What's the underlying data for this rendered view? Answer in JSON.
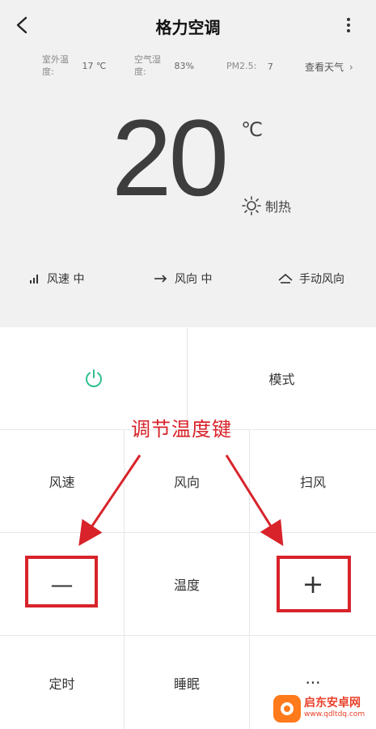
{
  "header": {
    "title": "格力空调"
  },
  "info": {
    "outdoor_temp_label": "室外温度:",
    "outdoor_temp_value": "17 ℃",
    "humidity_label": "空气湿度:",
    "humidity_value": "83%",
    "pm25_label": "PM2.5:",
    "pm25_value": "7",
    "weather_link": "查看天气"
  },
  "display": {
    "temperature": "20",
    "unit": "℃",
    "mode": "制热"
  },
  "status": {
    "fan_speed": "风速 中",
    "wind_direction": "风向 中",
    "manual_direction": "手动风向"
  },
  "controls": {
    "mode_label": "模式",
    "fan_speed_label": "风速",
    "wind_direction_label": "风向",
    "swing_label": "扫风",
    "temperature_label": "温度",
    "minus_label": "—",
    "plus_label": "+",
    "timer_label": "定时",
    "sleep_label": "睡眠",
    "more_label": "···"
  },
  "annotation": {
    "text": "调节温度键",
    "color": "#d8232a"
  },
  "watermark": {
    "name": "启东安卓网",
    "url": "www.qdltdq.com"
  },
  "colors": {
    "power_icon": "#2fbf8f",
    "annotation_red": "#d8232a"
  }
}
